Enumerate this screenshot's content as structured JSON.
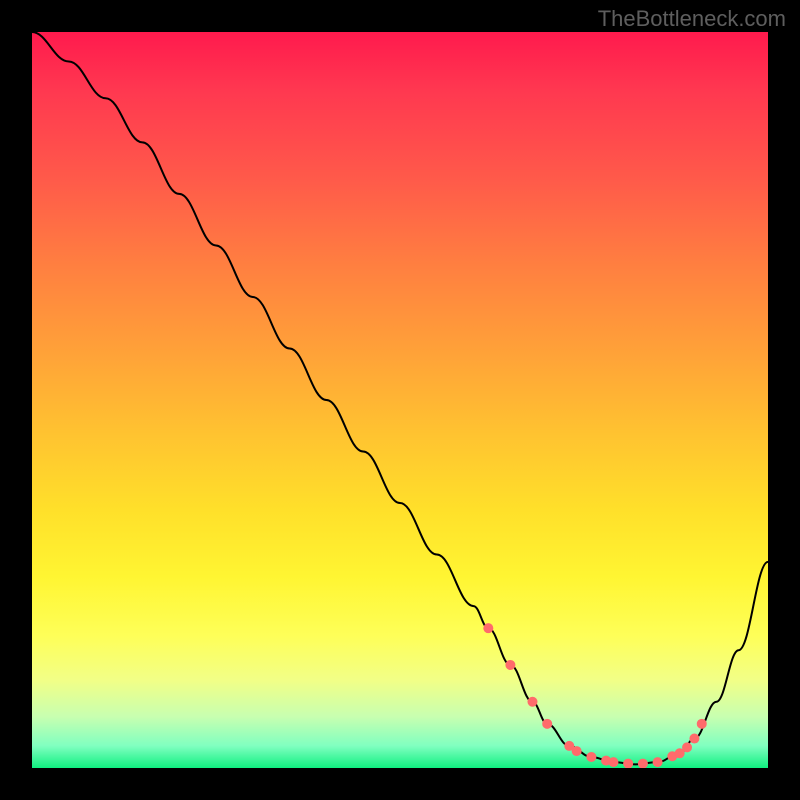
{
  "watermark": "TheBottleneck.com",
  "chart_data": {
    "type": "line",
    "title": "",
    "xlabel": "",
    "ylabel": "",
    "xlim": [
      0,
      100
    ],
    "ylim": [
      0,
      100
    ],
    "series": [
      {
        "name": "bottleneck-curve",
        "x": [
          0,
          5,
          10,
          15,
          20,
          25,
          30,
          35,
          40,
          45,
          50,
          55,
          60,
          62,
          65,
          68,
          70,
          73,
          76,
          79,
          82,
          85,
          88,
          90,
          93,
          96,
          100
        ],
        "values": [
          100,
          96,
          91,
          85,
          78,
          71,
          64,
          57,
          50,
          43,
          36,
          29,
          22,
          19,
          14,
          9,
          6,
          3,
          1.5,
          0.8,
          0.5,
          0.8,
          2,
          4,
          9,
          16,
          28
        ]
      }
    ],
    "highlight_points": {
      "name": "optimal-range-dots",
      "color": "#ff6b6b",
      "x": [
        62,
        65,
        68,
        70,
        73,
        74,
        76,
        78,
        79,
        81,
        83,
        85,
        87,
        88,
        89,
        90,
        91
      ],
      "values": [
        19,
        14,
        9,
        6,
        3,
        2.3,
        1.5,
        1,
        0.8,
        0.6,
        0.6,
        0.8,
        1.6,
        2,
        2.8,
        4,
        6
      ]
    }
  }
}
